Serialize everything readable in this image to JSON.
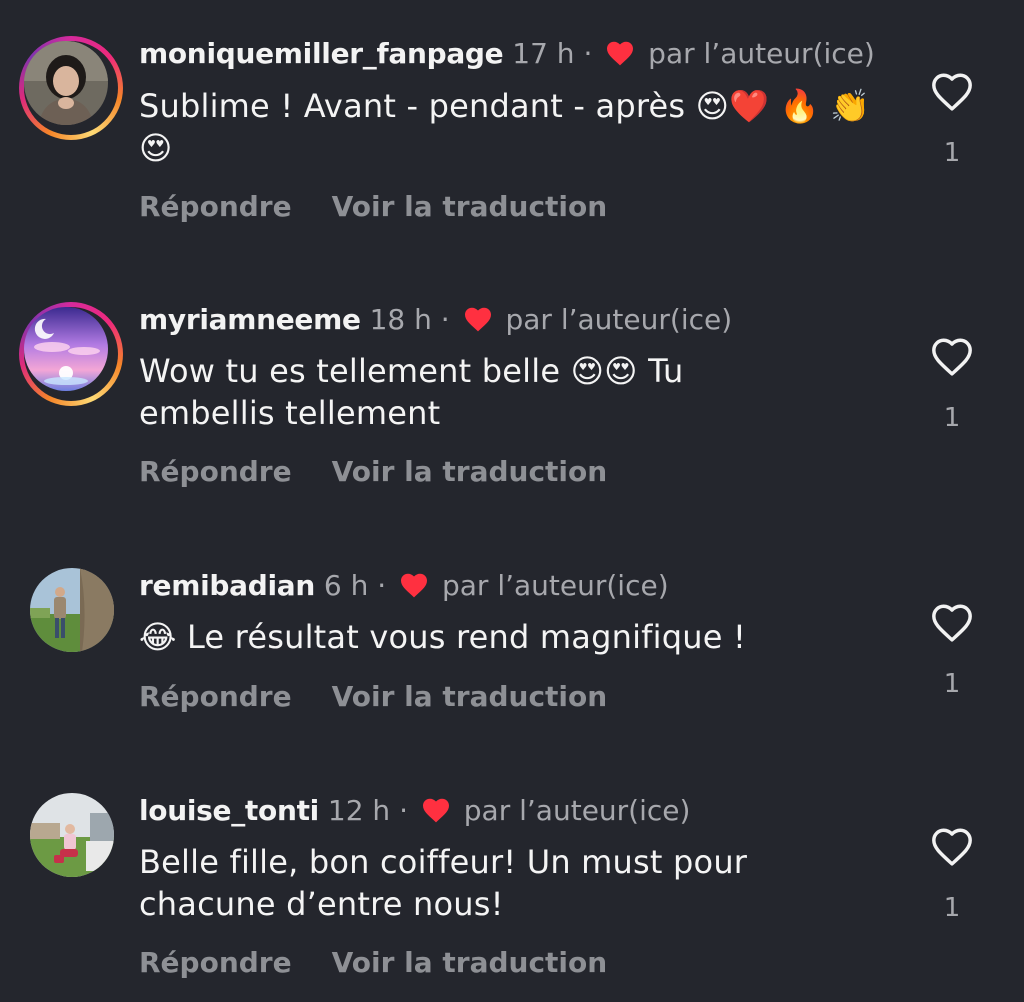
{
  "comments": [
    {
      "username": "moniquemiller_fanpage",
      "time": "17 h",
      "separator": "·",
      "liked_by_author": "par l’auteur(ice)",
      "text": "Sublime ! Avant - pendant - après 😍❤️ 🔥 👏😍",
      "reply_label": "Répondre",
      "translate_label": "Voir la traduction",
      "like_count": "1",
      "avatar_ring": true
    },
    {
      "username": "myriamneeme",
      "time": "18 h",
      "separator": "·",
      "liked_by_author": "par l’auteur(ice)",
      "text": "Wow tu es tellement belle 😍😍 Tu embellis tellement",
      "reply_label": "Répondre",
      "translate_label": "Voir la traduction",
      "like_count": "1",
      "avatar_ring": true
    },
    {
      "username": "remibadian",
      "time": "6 h",
      "separator": "·",
      "liked_by_author": "par l’auteur(ice)",
      "text": "😂 Le résultat vous rend magnifique !",
      "reply_label": "Répondre",
      "translate_label": "Voir la traduction",
      "like_count": "1",
      "avatar_ring": false
    },
    {
      "username": "louise_tonti",
      "time": "12 h",
      "separator": "·",
      "liked_by_author": "par l’auteur(ice)",
      "text": "Belle fille, bon coiffeur! Un must pour chacune d’entre nous!",
      "reply_label": "Répondre",
      "translate_label": "Voir la traduction",
      "like_count": "1",
      "avatar_ring": false
    }
  ],
  "colors": {
    "background": "#24262d",
    "author_heart": "#ff3040",
    "story_ring": "#ee2a7b"
  },
  "icons": {
    "like": "heart-outline-icon",
    "author_like": "heart-filled-icon"
  }
}
